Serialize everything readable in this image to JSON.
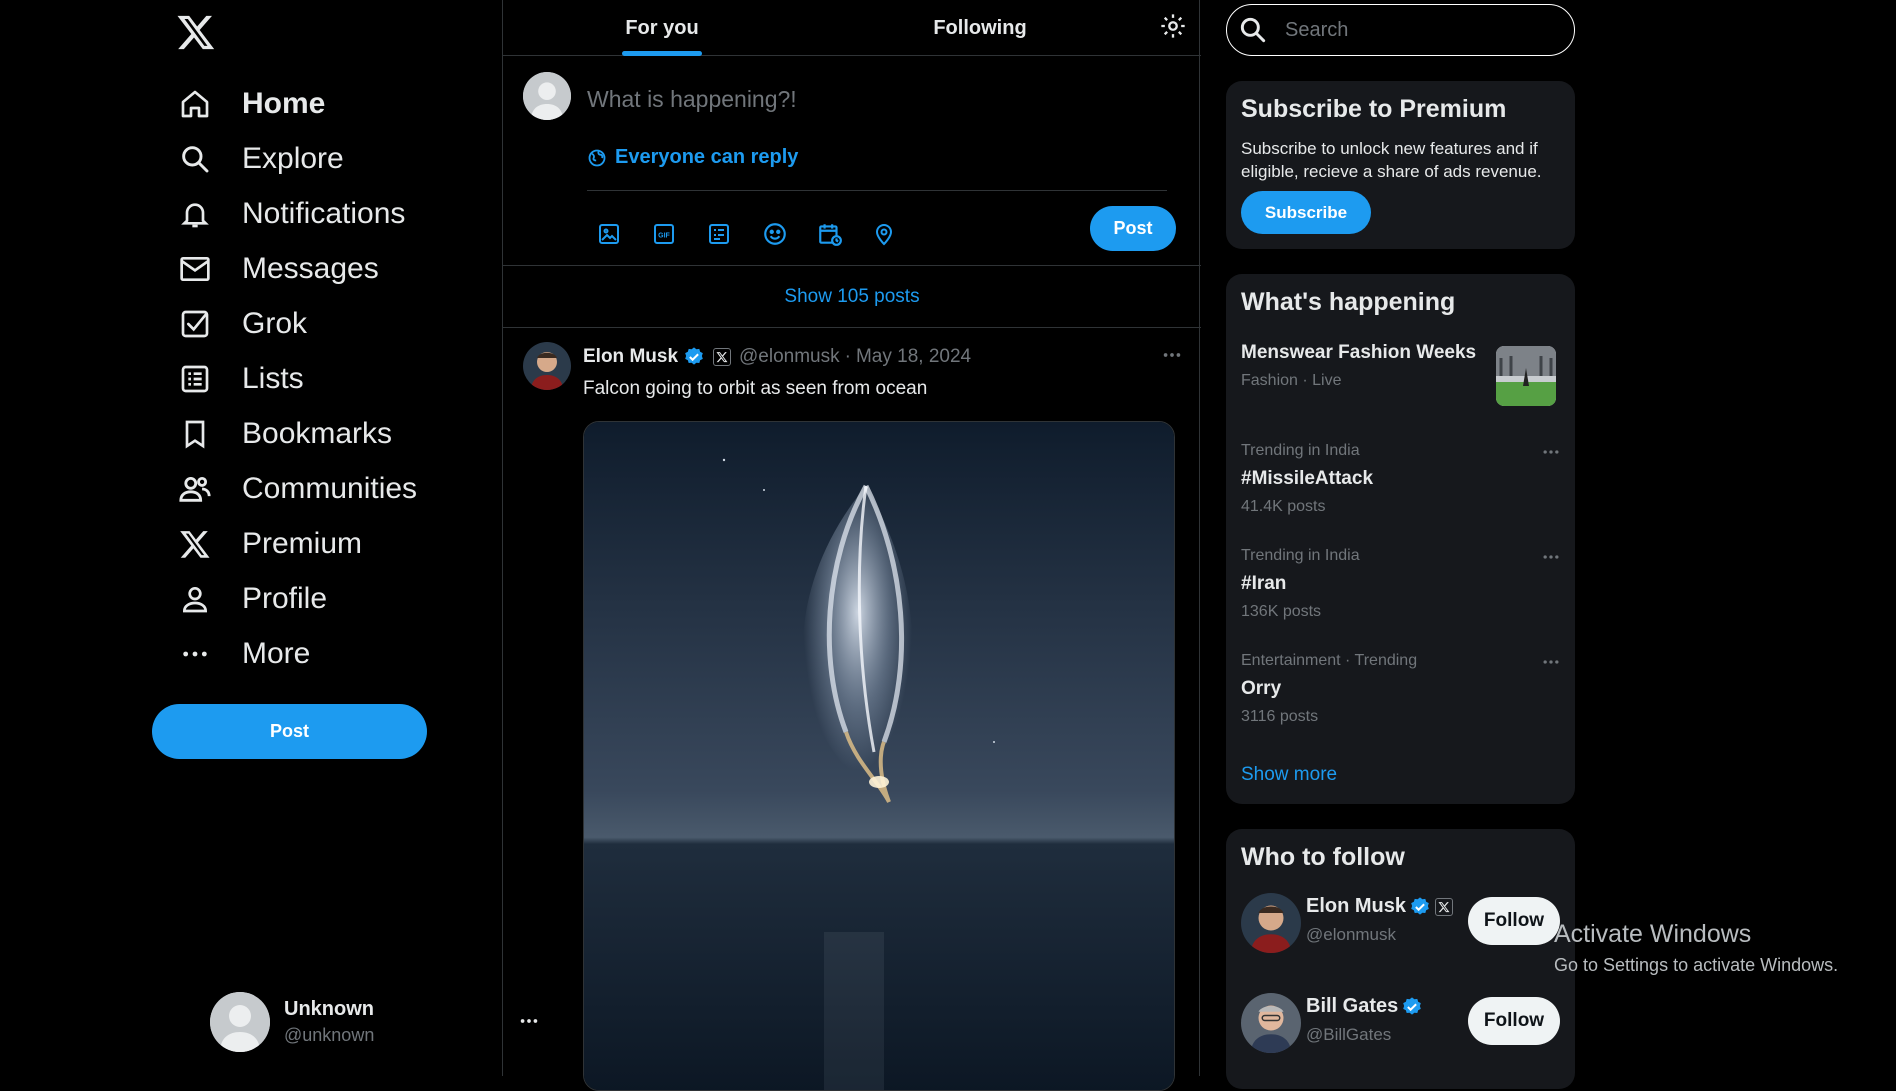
{
  "sidebar": {
    "logo": "x-logo",
    "items": [
      {
        "label": "Home",
        "icon": "home-icon"
      },
      {
        "label": "Explore",
        "icon": "search-icon"
      },
      {
        "label": "Notifications",
        "icon": "bell-icon"
      },
      {
        "label": "Messages",
        "icon": "envelope-icon"
      },
      {
        "label": "Grok",
        "icon": "grok-icon"
      },
      {
        "label": "Lists",
        "icon": "list-icon"
      },
      {
        "label": "Bookmarks",
        "icon": "bookmark-icon"
      },
      {
        "label": "Communities",
        "icon": "people-icon"
      },
      {
        "label": "Premium",
        "icon": "x-logo-icon"
      },
      {
        "label": "Profile",
        "icon": "person-icon"
      },
      {
        "label": "More",
        "icon": "more-dots-icon"
      }
    ],
    "post_button": "Post",
    "user": {
      "name": "Unknown",
      "handle": "@unknown"
    }
  },
  "header": {
    "tabs": [
      {
        "label": "For you",
        "active": true
      },
      {
        "label": "Following",
        "active": false
      }
    ],
    "settings_icon": "gear-icon"
  },
  "composer": {
    "placeholder": "What is happening?!",
    "reply_setting": "Everyone can reply",
    "tools": [
      "image-icon",
      "gif-icon",
      "poll-icon",
      "emoji-icon",
      "schedule-icon",
      "location-icon"
    ],
    "post_button": "Post"
  },
  "feed": {
    "show_posts": "Show 105 posts",
    "tweet": {
      "name": "Elon Musk",
      "handle": "@elonmusk",
      "separator": "·",
      "date": "May 18, 2024",
      "text": "Falcon going to orbit as seen from ocean"
    }
  },
  "search": {
    "placeholder": "Search"
  },
  "premium": {
    "title": "Subscribe to Premium",
    "description": "Subscribe to unlock new features and if eligible, recieve a share of ads revenue.",
    "button": "Subscribe"
  },
  "trending": {
    "title": "What's happening",
    "items": [
      {
        "context": "Fashion · Live",
        "title": "Menswear Fashion Weeks",
        "count": ""
      },
      {
        "context": "Trending in India",
        "title": "#MissileAttack",
        "count": "41.4K posts"
      },
      {
        "context": "Trending in India",
        "title": "#Iran",
        "count": "136K posts"
      },
      {
        "context": "Entertainment · Trending",
        "title": "Orry",
        "count": "3116 posts"
      }
    ],
    "show_more": "Show more"
  },
  "who_to_follow": {
    "title": "Who to follow",
    "users": [
      {
        "name": "Elon Musk",
        "handle": "@elonmusk",
        "button": "Follow"
      },
      {
        "name": "Bill Gates",
        "handle": "@BillGates",
        "button": "Follow"
      }
    ]
  },
  "watermark": {
    "line1": "Activate Windows",
    "line2": "Go to Settings to activate Windows."
  },
  "colors": {
    "accent": "#1d9bf0",
    "background": "#000000",
    "card": "#16181c",
    "muted": "#71767b"
  }
}
